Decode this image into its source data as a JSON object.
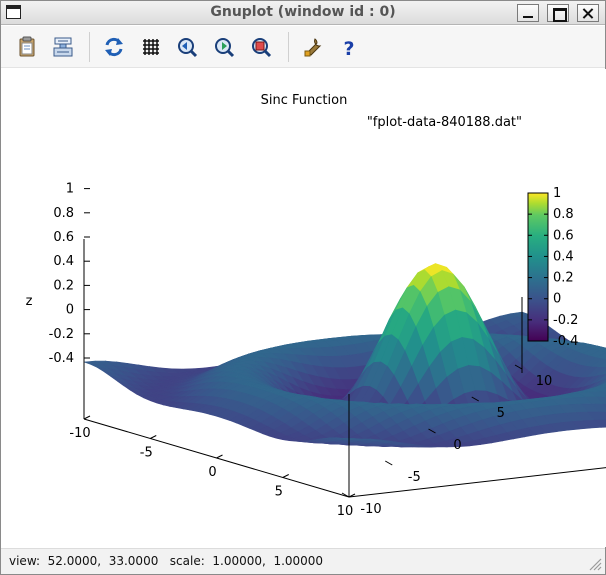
{
  "window": {
    "title": "Gnuplot (window id : 0)",
    "controls": [
      "minimize",
      "maximize",
      "close"
    ]
  },
  "toolbar": {
    "buttons": [
      {
        "icon": "clipboard-copy-icon",
        "tooltip": ""
      },
      {
        "icon": "print-icon",
        "tooltip": ""
      },
      {
        "icon": "replot-icon",
        "tooltip": ""
      },
      {
        "icon": "grid-icon",
        "tooltip": ""
      },
      {
        "icon": "zoom-previous-icon",
        "tooltip": ""
      },
      {
        "icon": "zoom-next-icon",
        "tooltip": ""
      },
      {
        "icon": "autoscale-icon",
        "tooltip": ""
      },
      {
        "icon": "options-wrench-icon",
        "tooltip": ""
      },
      {
        "icon": "help-icon",
        "tooltip": ""
      }
    ]
  },
  "plot": {
    "title": "Sinc Function",
    "key_entry": "\"fplot-data-840188.dat\"",
    "zlabel": "z",
    "z_ticks": [
      "1",
      "0.8",
      "0.6",
      "0.4",
      "0.2",
      "0",
      "-0.2",
      "-0.4"
    ],
    "x_ticks": [
      "-10",
      "-5",
      "0",
      "5",
      "10"
    ],
    "y_ticks": [
      "-10",
      "-5",
      "0",
      "5",
      "10"
    ],
    "colorbox_ticks": [
      "1",
      "0.8",
      "0.6",
      "0.4",
      "0.2",
      "0",
      "-0.2",
      "-0.4"
    ],
    "palette": [
      "#440154",
      "#3b528b",
      "#21918c",
      "#5ec962",
      "#fde725"
    ]
  },
  "chart_data": {
    "type": "surface",
    "title": "Sinc Function",
    "function": "sin(r)/r",
    "xlim": [
      -10,
      10
    ],
    "ylim": [
      -10,
      10
    ],
    "zlim": [
      -0.4,
      1
    ],
    "zlabel": "z",
    "view": {
      "rot_x": 52,
      "rot_z": 33
    },
    "colorbar": {
      "min": -0.4,
      "max": 1,
      "palette": "viridis"
    },
    "legend": "\"fplot-data-840188.dat\""
  },
  "status": {
    "text": "view:  52.0000,  33.0000   scale:  1.00000,  1.00000"
  }
}
